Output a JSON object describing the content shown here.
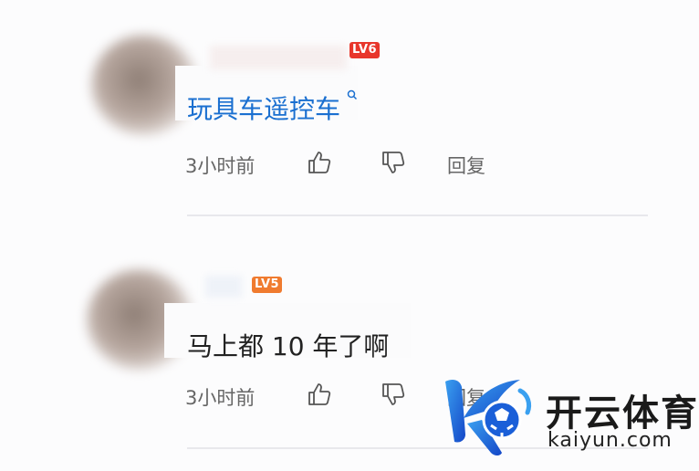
{
  "comments": [
    {
      "level": "LV6",
      "text": "玩具车遥控车",
      "is_search_link": true,
      "time": "3小时前",
      "reply_label": "回复"
    },
    {
      "level": "LV5",
      "text": "马上都 10 年了啊",
      "is_search_link": false,
      "time": "3小时前",
      "reply_label": "回复"
    }
  ],
  "watermark": {
    "name": "开云体育",
    "url": "kaiyun.com"
  },
  "colors": {
    "link": "#1a6fd0",
    "lv6": "#e8362b",
    "lv5": "#f07b2f",
    "brand_blue": "#1f6fe0"
  }
}
